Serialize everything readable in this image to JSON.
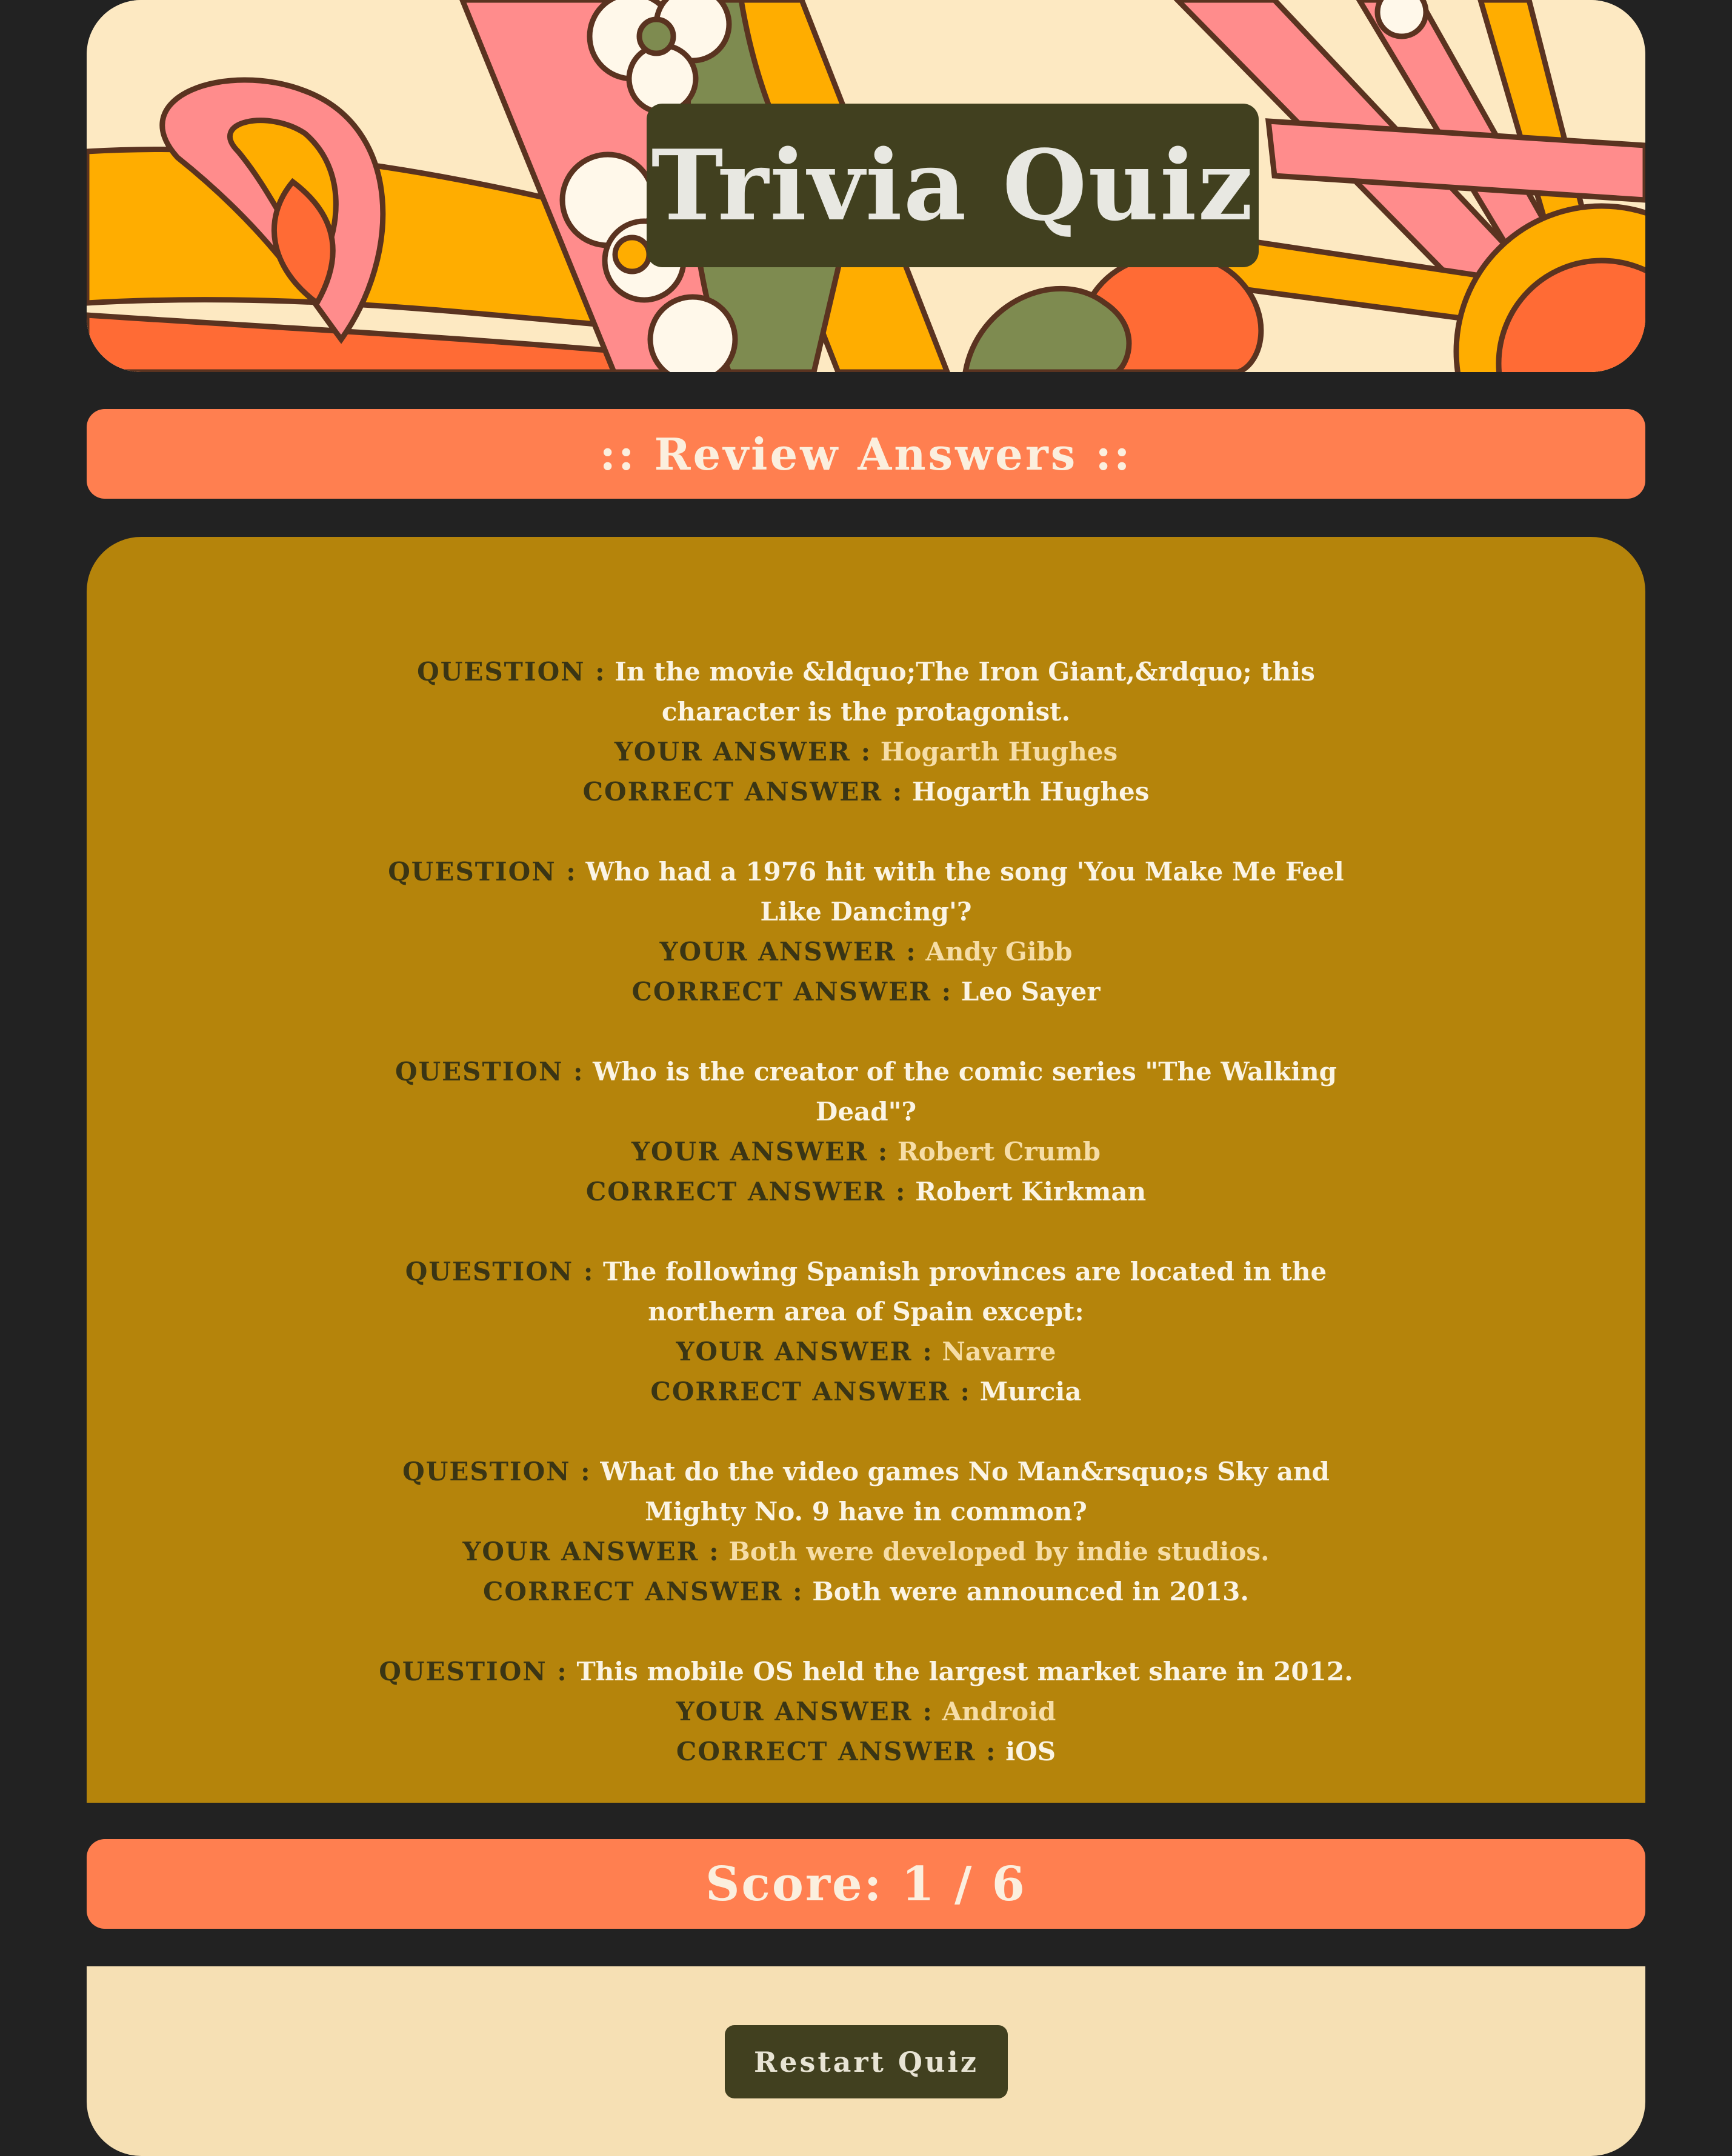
{
  "header": {
    "title": "Trivia Quiz"
  },
  "review": {
    "heading": ":: Review Answers ::",
    "labels": {
      "question": "QUESTION :",
      "your_answer": "YOUR ANSWER :",
      "correct_answer": "CORRECT ANSWER :"
    },
    "items": [
      {
        "question": "In the movie &ldquo;The Iron Giant,&rdquo; this character is the protagonist.",
        "your_answer": "Hogarth Hughes",
        "correct_answer": "Hogarth Hughes"
      },
      {
        "question": "Who had a 1976 hit with the song 'You Make Me Feel Like Dancing'?",
        "your_answer": "Andy Gibb",
        "correct_answer": "Leo Sayer"
      },
      {
        "question": "Who is the creator of the comic series \"The Walking Dead\"?",
        "your_answer": "Robert Crumb",
        "correct_answer": "Robert Kirkman"
      },
      {
        "question": "The following Spanish provinces are located in the northern area of Spain except:",
        "your_answer": "Navarre",
        "correct_answer": "Murcia"
      },
      {
        "question": "What do the video games No Man&rsquo;s Sky and Mighty No. 9 have in common?",
        "your_answer": "Both were developed by indie studios.",
        "correct_answer": "Both were announced in 2013."
      },
      {
        "question": "This mobile OS held the largest market share in 2012.",
        "your_answer": "Android",
        "correct_answer": "iOS"
      }
    ]
  },
  "score": {
    "text": "Score: 1 / 6"
  },
  "footer": {
    "restart_label": "Restart Quiz"
  },
  "colors": {
    "page_background": "#222222",
    "accent_pill": "#FF7F50",
    "answers_panel": "#B5840B",
    "footer_panel": "#F6E0B4",
    "dark_olive": "#41401F"
  }
}
